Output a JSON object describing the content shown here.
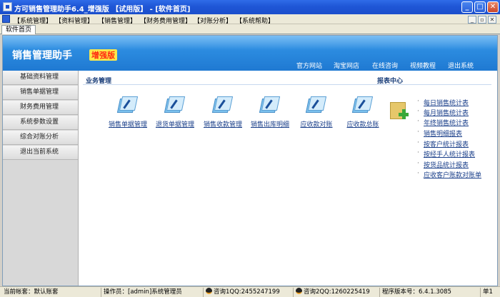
{
  "window": {
    "title": "方可销售管理助手6.4_增强版 【试用版】 - [软件首页]",
    "minimize_glyph": "_",
    "maximize_glyph": "□",
    "close_glyph": "✕"
  },
  "menu": [
    "【系统管理】",
    "【资料管理】",
    "【销售管理】",
    "【财务费用管理】",
    "【对账分析】",
    "【系统帮助】"
  ],
  "mdi_controls": [
    "_",
    "▫",
    "✕"
  ],
  "tab": {
    "label": "软件首页"
  },
  "banner": {
    "title": "销售管理助手",
    "badge": "增强版",
    "links": [
      "官方网站",
      "淘宝网店",
      "在线咨询",
      "视频教程",
      "退出系统"
    ]
  },
  "sidebar": [
    "基础资料管理",
    "销售单据管理",
    "财务费用管理",
    "系统参数设置",
    "综合对账分析",
    "退出当前系统"
  ],
  "business": {
    "title": "业务管理",
    "items": [
      "销售单据管理",
      "退货单据管理",
      "销售收款管理",
      "销售出库明细",
      "应收款对账",
      "应收款总账"
    ]
  },
  "reports": {
    "title": "报表中心",
    "items": [
      "每日销售统计表",
      "每月销售统计表",
      "年终销售统计表",
      "销售明细报表",
      "按客户统计报表",
      "按经手人统计报表",
      "按货品统计报表",
      "应收客户账款对账单"
    ]
  },
  "status": {
    "account": "当前帐套：默认账套",
    "operator": "操作员：[admin]系统管理员",
    "qq1": "咨询1QQ:2455247199",
    "qq2": "咨询2QQ:1260225419",
    "version": "程序版本号：6.4.1.3085",
    "tail": "单1"
  },
  "colors": {
    "titlebar": "#1f56d6",
    "banner": "#2c8ce0",
    "badge_bg": "#ffe94a",
    "badge_text": "#ff2a10",
    "link": "#1a3f8a"
  }
}
